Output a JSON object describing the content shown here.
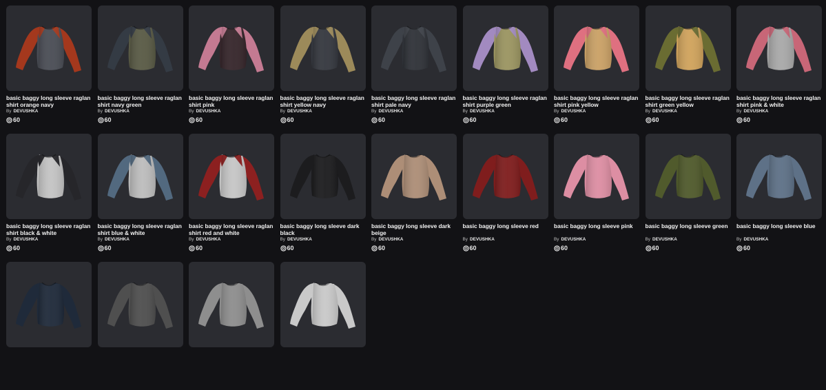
{
  "catalog": {
    "items": [
      {
        "title": "basic baggy long sleeve raglan shirt orange navy",
        "by": "By",
        "creator": "DEVUSHKA",
        "price": "60",
        "sleeve_color": "#a4381d",
        "body_color": "#4a4d55"
      },
      {
        "title": "basic baggy long sleeve raglan shirt navy green",
        "by": "By",
        "creator": "DEVUSHKA",
        "price": "60",
        "sleeve_color": "#343b44",
        "body_color": "#595a45"
      },
      {
        "title": "basic baggy long sleeve raglan shirt pink",
        "by": "By",
        "creator": "DEVUSHKA",
        "price": "60",
        "sleeve_color": "#c47a92",
        "body_color": "#36262b"
      },
      {
        "title": "basic baggy long sleeve raglan shirt yellow navy",
        "by": "By",
        "creator": "DEVUSHKA",
        "price": "60",
        "sleeve_color": "#9c8a5a",
        "body_color": "#35383f"
      },
      {
        "title": "basic baggy long sleeve raglan shirt pale navy",
        "by": "By",
        "creator": "DEVUSHKA",
        "price": "60",
        "sleeve_color": "#3e4249",
        "body_color": "#2f3238"
      },
      {
        "title": "basic baggy long sleeve raglan shirt purple green",
        "by": "By",
        "creator": "DEVUSHKA",
        "price": "60",
        "sleeve_color": "#a28ac0",
        "body_color": "#9b9561"
      },
      {
        "title": "basic baggy long sleeve raglan shirt pink yellow",
        "by": "By",
        "creator": "DEVUSHKA",
        "price": "60",
        "sleeve_color": "#df7080",
        "body_color": "#caa166"
      },
      {
        "title": "basic baggy long sleeve raglan shirt green yellow",
        "by": "By",
        "creator": "DEVUSHKA",
        "price": "60",
        "sleeve_color": "#6a6c32",
        "body_color": "#d0a35c"
      },
      {
        "title": "basic baggy long sleeve raglan shirt pink & white",
        "by": "By",
        "creator": "DEVUSHKA",
        "price": "60",
        "sleeve_color": "#c86677",
        "body_color": "#a9a9a9"
      },
      {
        "title": "basic baggy long sleeve raglan shirt black & white",
        "by": "By",
        "creator": "DEVUSHKA",
        "price": "60",
        "sleeve_color": "#26262a",
        "body_color": "#c4c4c4"
      },
      {
        "title": "basic baggy long sleeve raglan shirt blue & white",
        "by": "By",
        "creator": "DEVUSHKA",
        "price": "60",
        "sleeve_color": "#52697f",
        "body_color": "#bdbdbd"
      },
      {
        "title": "basic baggy long sleeve raglan shirt red and white",
        "by": "By",
        "creator": "DEVUSHKA",
        "price": "60",
        "sleeve_color": "#8c2020",
        "body_color": "#c6c6c6"
      },
      {
        "title": "basic baggy long sleeve dark black",
        "by": "By",
        "creator": "DEVUSHKA",
        "price": "60",
        "sleeve_color": "#1c1c1e",
        "body_color": "#1c1c1e"
      },
      {
        "title": "basic baggy long sleeve dark beige",
        "by": "By",
        "creator": "DEVUSHKA",
        "price": "60",
        "sleeve_color": "#ad8e77",
        "body_color": "#ad8e77"
      },
      {
        "title": "basic baggy long sleeve red",
        "by": "By",
        "creator": "DEVUSHKA",
        "price": "60",
        "sleeve_color": "#7f1d1d",
        "body_color": "#7f1d1d"
      },
      {
        "title": "basic baggy long sleeve pink",
        "by": "By",
        "creator": "DEVUSHKA",
        "price": "60",
        "sleeve_color": "#dd8ea3",
        "body_color": "#dd8ea3"
      },
      {
        "title": "basic baggy long sleeve green",
        "by": "By",
        "creator": "DEVUSHKA",
        "price": "60",
        "sleeve_color": "#505a2c",
        "body_color": "#505a2c"
      },
      {
        "title": "basic baggy long sleeve blue",
        "by": "By",
        "creator": "DEVUSHKA",
        "price": "60",
        "sleeve_color": "#5e7187",
        "body_color": "#5e7187"
      },
      {
        "title": "",
        "by": "",
        "creator": "",
        "price": "",
        "sleeve_color": "#1f2a3a",
        "body_color": "#1f2a3a"
      },
      {
        "title": "",
        "by": "",
        "creator": "",
        "price": "",
        "sleeve_color": "#4f4f4f",
        "body_color": "#4f4f4f"
      },
      {
        "title": "",
        "by": "",
        "creator": "",
        "price": "",
        "sleeve_color": "#8e8e8e",
        "body_color": "#8e8e8e"
      },
      {
        "title": "",
        "by": "",
        "creator": "",
        "price": "",
        "sleeve_color": "#c9c9c9",
        "body_color": "#c9c9c9"
      }
    ]
  }
}
